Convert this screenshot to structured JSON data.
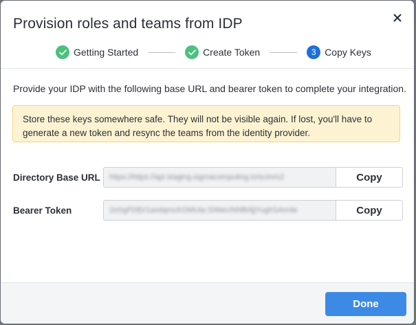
{
  "modal": {
    "title": "Provision roles and teams from IDP",
    "close_icon": "close-icon"
  },
  "stepper": {
    "steps": [
      {
        "label": "Getting Started",
        "status": "done",
        "icon": "check-icon"
      },
      {
        "label": "Create Token",
        "status": "done",
        "icon": "check-icon"
      },
      {
        "label": "Copy Keys",
        "status": "active",
        "number": "3"
      }
    ]
  },
  "content": {
    "intro": "Provide your IDP with the following base URL and bearer token to complete your integration.",
    "warning": "Store these keys somewhere safe. They will not be visible again. If lost, you'll have to generate a new token and resync the teams from the identity provider.",
    "fields": [
      {
        "label": "Directory Base URL",
        "value": "https://https://api.staging.sigmacomputing.io/scim/v2",
        "copy_label": "Copy"
      },
      {
        "label": "Bearer Token",
        "value": "2oSgFDfjV1asdqmcKOMUta.SiWeUNNfk9jjYughSAm4e",
        "copy_label": "Copy"
      }
    ]
  },
  "footer": {
    "done_label": "Done"
  },
  "colors": {
    "accent": "#3d8ae6",
    "step_active": "#1d6fd8",
    "step_done": "#4cc17f",
    "warning_bg": "#fdf3d2",
    "warning_border": "#f1d57d"
  }
}
